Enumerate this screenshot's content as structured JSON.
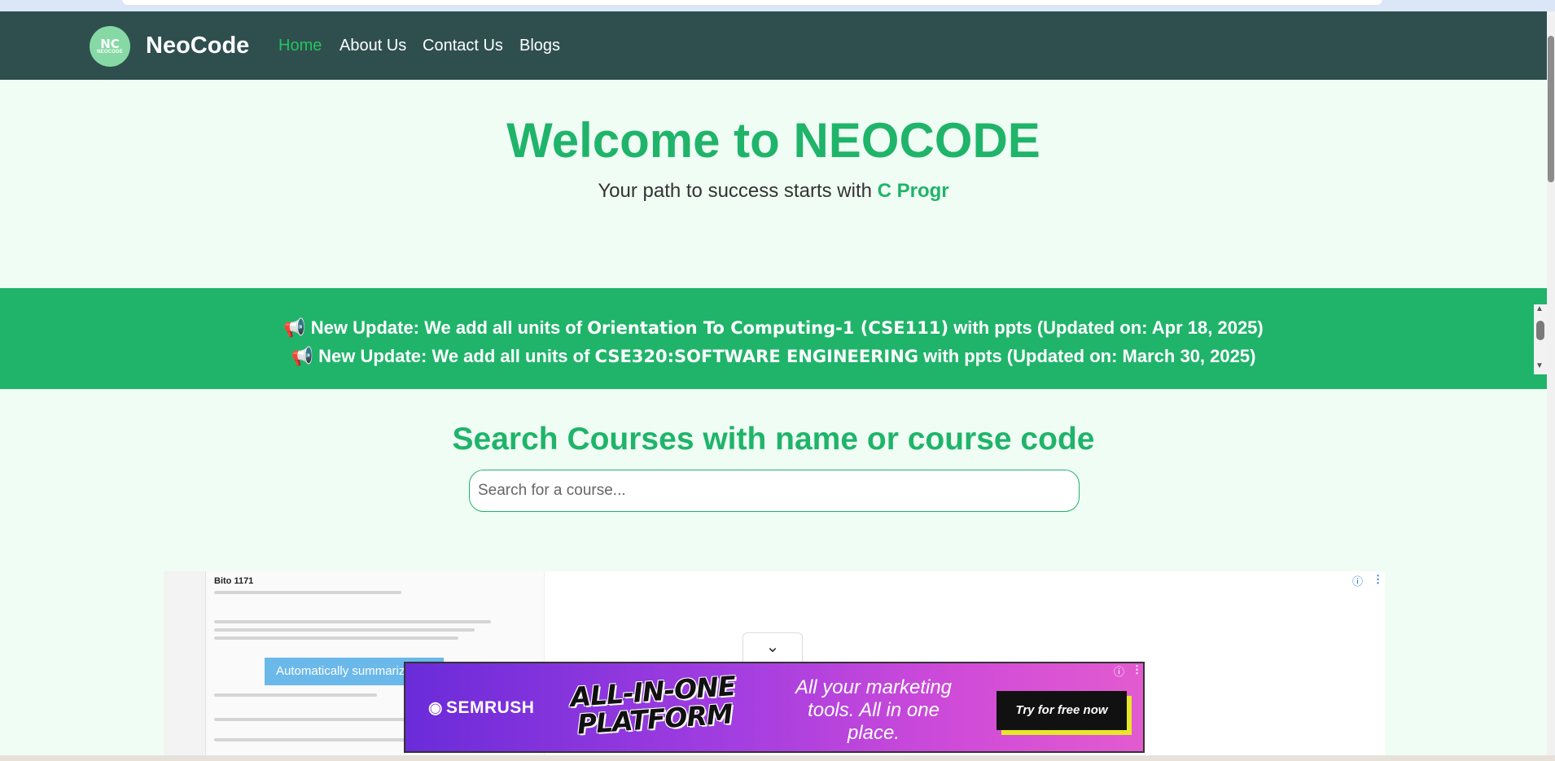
{
  "nav": {
    "logo": {
      "glyph": "NC",
      "text": "NEOCODE"
    },
    "brand": "NeoCode",
    "links": [
      "Home",
      "About Us",
      "Contact Us",
      "Blogs"
    ],
    "active_link": "Home"
  },
  "hero": {
    "title": "Welcome to NEOCODE",
    "subtitle_prefix": "Your path to success starts with",
    "subtitle_highlight": "C Progr"
  },
  "updates": [
    {
      "icon": "megaphone-icon",
      "emoji": "📢",
      "prefix": "New Update: We add all units of",
      "course": "Orientation To Computing-1 (CSE111)",
      "suffix": "with ppts (Updated on: Apr 18, 2025)"
    },
    {
      "icon": "megaphone-icon",
      "emoji": "📢",
      "prefix": "New Update: We add all units of",
      "course": "CSE320:SOFTWARE ENGINEERING",
      "suffix": "with ppts (Updated on: March 30, 2025)"
    }
  ],
  "search": {
    "heading": "Search Courses with name or course code",
    "placeholder": "Search for a course..."
  },
  "ad": {
    "screenshot_title": "Bito 1171",
    "screenshot_tooltip": "Automatically summariz",
    "semrush_brand": "SEMRUSH",
    "semrush_headline": "ALL-IN-ONE PLATFORM",
    "semrush_tagline": "All your marketing tools. All in one place.",
    "semrush_cta": "Try for free now"
  },
  "colors": {
    "navbar": "#2f4f4f",
    "accent": "#1fb46a",
    "background": "#f0fdf4"
  }
}
